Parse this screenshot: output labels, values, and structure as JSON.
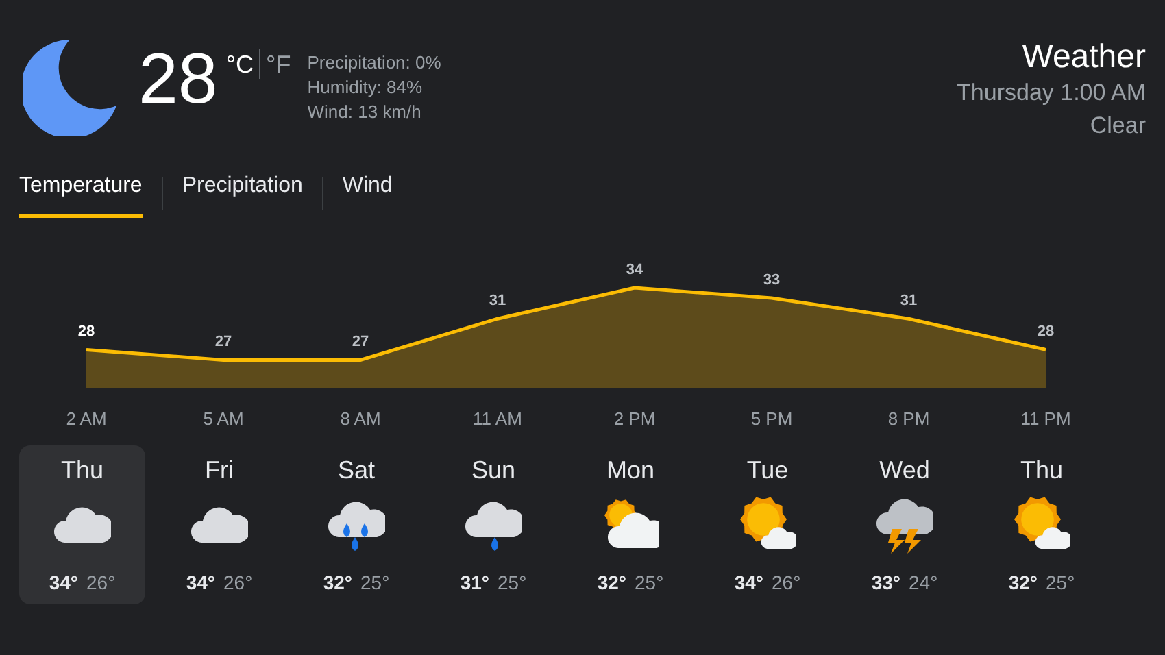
{
  "current": {
    "temperature": "28",
    "units": [
      {
        "label": "°C",
        "selected": true
      },
      {
        "label": "°F",
        "selected": false
      }
    ],
    "details": [
      "Precipitation: 0%",
      "Humidity: 84%",
      "Wind: 13 km/h"
    ]
  },
  "header": {
    "title": "Weather",
    "time": "Thursday 1:00 AM",
    "condition": "Clear"
  },
  "tabs": [
    {
      "label": "Temperature",
      "selected": true
    },
    {
      "label": "Precipitation",
      "selected": false
    },
    {
      "label": "Wind",
      "selected": false
    }
  ],
  "chart_data": {
    "type": "area",
    "categories": [
      "2 AM",
      "5 AM",
      "8 AM",
      "11 AM",
      "2 PM",
      "5 PM",
      "8 PM",
      "11 PM"
    ],
    "values": [
      28,
      27,
      27,
      31,
      34,
      33,
      31,
      28
    ],
    "data_labels": true
  },
  "days": [
    {
      "day": "Thu",
      "kind": "cloudy",
      "high": "34°",
      "low": "26°",
      "selected": true
    },
    {
      "day": "Fri",
      "kind": "cloudy",
      "high": "34°",
      "low": "26°",
      "selected": false
    },
    {
      "day": "Sat",
      "kind": "heavy-rain",
      "high": "32°",
      "low": "25°",
      "selected": false
    },
    {
      "day": "Sun",
      "kind": "rain",
      "high": "31°",
      "low": "25°",
      "selected": false
    },
    {
      "day": "Mon",
      "kind": "partly-cloudy",
      "high": "32°",
      "low": "25°",
      "selected": false
    },
    {
      "day": "Tue",
      "kind": "mostly-sunny",
      "high": "34°",
      "low": "26°",
      "selected": false
    },
    {
      "day": "Wed",
      "kind": "thunderstorm",
      "high": "33°",
      "low": "24°",
      "selected": false
    },
    {
      "day": "Thu",
      "kind": "mostly-sunny",
      "high": "32°",
      "low": "25°",
      "selected": false
    }
  ]
}
